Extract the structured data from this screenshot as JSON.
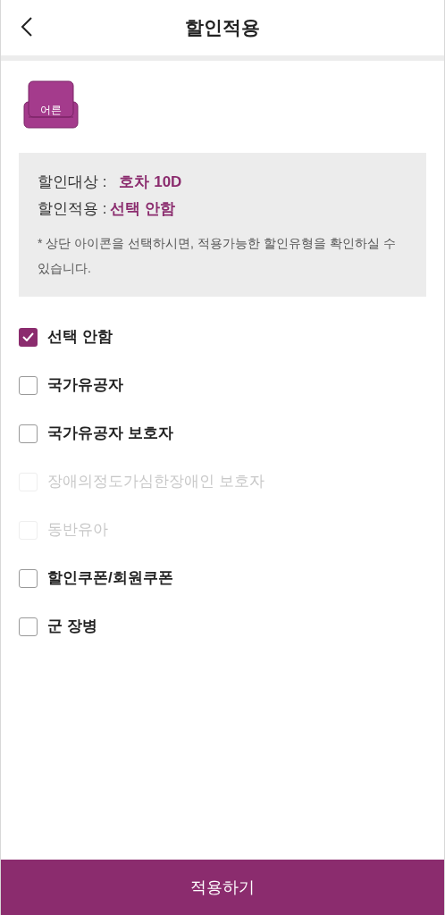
{
  "header": {
    "title": "할인적용"
  },
  "passengers": [
    {
      "label": "어른",
      "selected": true
    }
  ],
  "info": {
    "target_label": "할인대상 :",
    "target_value": "호차 10D",
    "applied_label": "할인적용 :",
    "applied_value": "선택 안함",
    "note": "* 상단 아이콘을 선택하시면, 적용가능한 할인유형을 확인하실 수 있습니다."
  },
  "options": [
    {
      "label": "선택 안함",
      "checked": true,
      "disabled": false
    },
    {
      "label": "국가유공자",
      "checked": false,
      "disabled": false
    },
    {
      "label": "국가유공자 보호자",
      "checked": false,
      "disabled": false
    },
    {
      "label": "장애의정도가심한장애인 보호자",
      "checked": false,
      "disabled": true
    },
    {
      "label": "동반유아",
      "checked": false,
      "disabled": true
    },
    {
      "label": "할인쿠폰/회원쿠폰",
      "checked": false,
      "disabled": false
    },
    {
      "label": "군 장병",
      "checked": false,
      "disabled": false
    }
  ],
  "apply_button": "적용하기"
}
